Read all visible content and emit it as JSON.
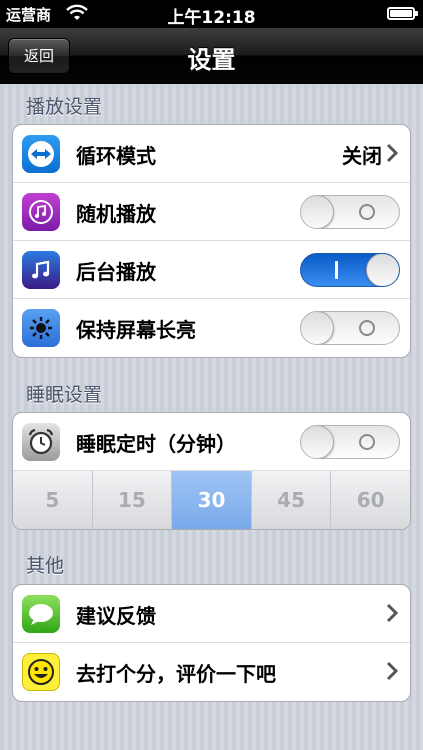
{
  "status_bar": {
    "carrier": "运营商",
    "time": "上午12:18"
  },
  "nav": {
    "back_label": "返回",
    "title": "设置"
  },
  "sections": {
    "playback": {
      "header": "播放设置",
      "rows": [
        {
          "label": "循环模式",
          "value": "关闭",
          "icon": "teamviewer-arrows-icon",
          "control": "disclosure"
        },
        {
          "label": "随机播放",
          "icon": "music-note-purple-icon",
          "control": "switch",
          "on": false
        },
        {
          "label": "后台播放",
          "icon": "music-note-blue-icon",
          "control": "switch",
          "on": true
        },
        {
          "label": "保持屏幕长亮",
          "icon": "sun-brightness-icon",
          "control": "switch",
          "on": false
        }
      ]
    },
    "sleep": {
      "header": "睡眠设置",
      "timer_label": "睡眠定时（分钟）",
      "timer_icon": "alarm-clock-icon",
      "timer_on": false,
      "options": [
        "5",
        "15",
        "30",
        "45",
        "60"
      ],
      "selected": "30"
    },
    "other": {
      "header": "其他",
      "rows": [
        {
          "label": "建议反馈",
          "icon": "message-bubble-icon"
        },
        {
          "label": "去打个分，评价一下吧",
          "icon": "smiley-face-icon"
        }
      ]
    }
  },
  "colors": {
    "switch_on": "#2a7de6",
    "segment_selected": "#8ab4ee",
    "section_header": "#4c566c"
  }
}
